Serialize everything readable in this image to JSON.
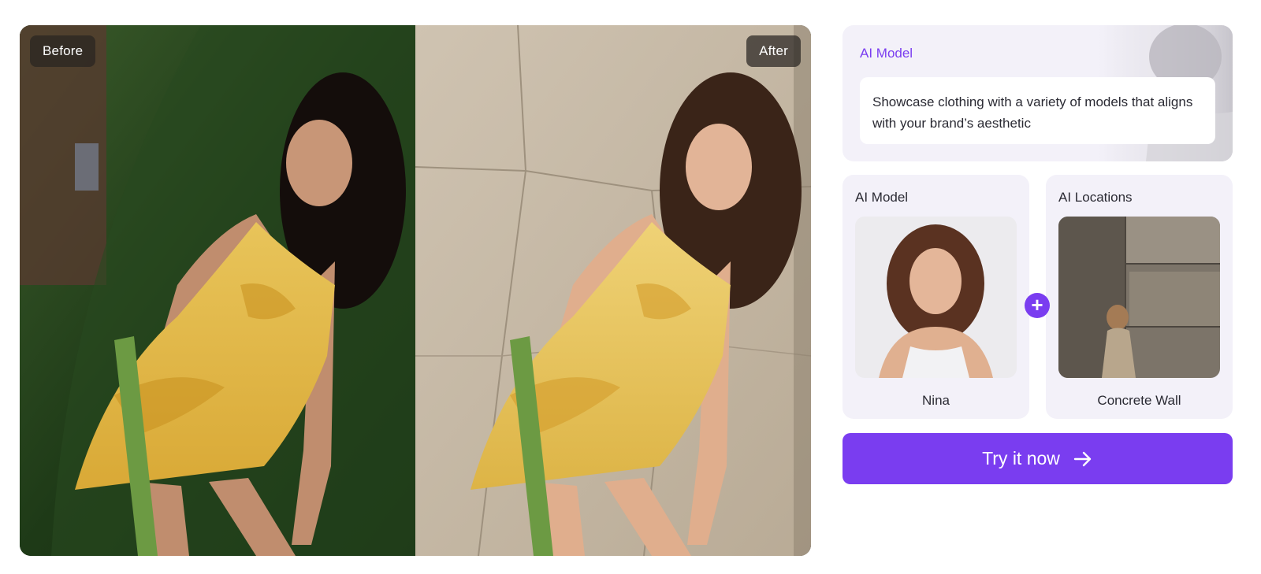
{
  "comparison": {
    "before_label": "Before",
    "after_label": "After"
  },
  "intro": {
    "title": "AI Model",
    "description": "Showcase clothing with a variety of models that aligns with your brand’s aesthetic"
  },
  "model_card": {
    "title": "AI Model",
    "name": "Nina"
  },
  "location_card": {
    "title": "AI Locations",
    "name": "Concrete Wall"
  },
  "plus_icon": "plus-icon",
  "cta": {
    "label": "Try it now",
    "icon": "arrow-right-icon"
  },
  "colors": {
    "accent": "#7a3df0",
    "card_bg": "#f3f1f9",
    "label_bg": "#282421",
    "text": "#2a2a33"
  }
}
